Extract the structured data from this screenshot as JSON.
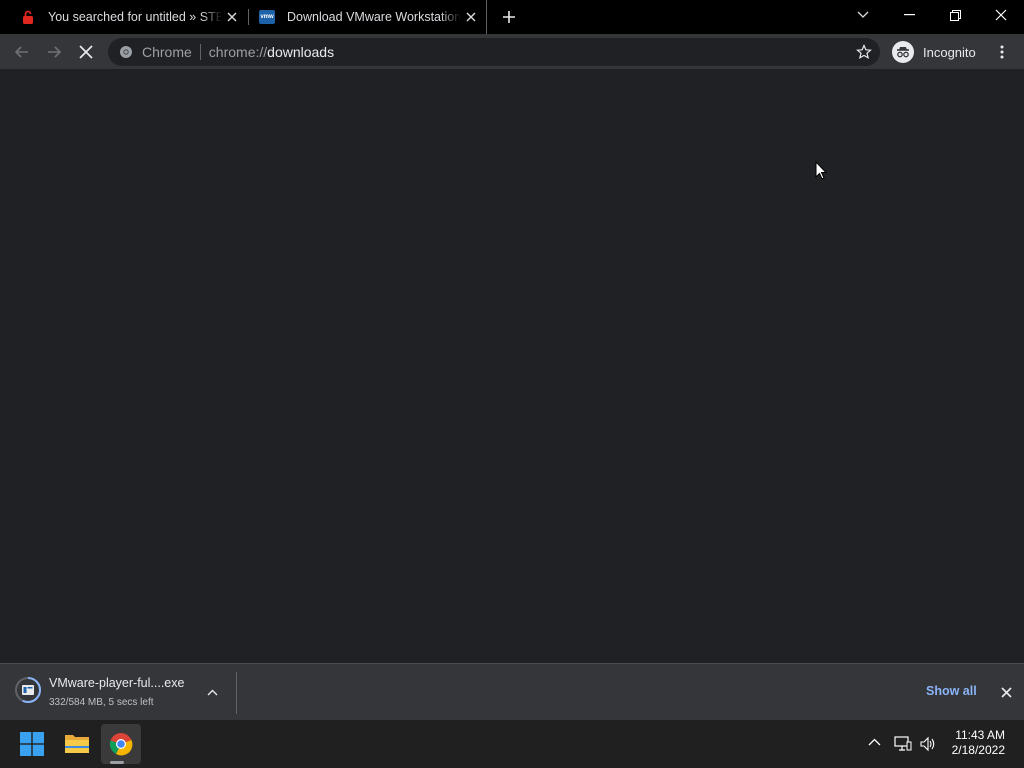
{
  "tabs": [
    {
      "title": "You searched for untitled » STEAM",
      "icon": "red-lock-icon"
    },
    {
      "title": "Download VMware Workstation Player",
      "icon": "vmware-icon",
      "favicon_text": "vmw"
    }
  ],
  "toolbar": {
    "site_chip": "Chrome",
    "url_scheme": "chrome://",
    "url_host": "downloads",
    "profile_label": "Incognito"
  },
  "download": {
    "filename": "VMware-player-ful....exe",
    "status": "332/584 MB, 5 secs left",
    "progress_fraction": 0.57,
    "show_all_label": "Show all"
  },
  "taskbar": {
    "time": "11:43 AM",
    "date": "2/18/2022"
  },
  "colors": {
    "accent": "#8ab4f8",
    "tab_strip": "#000000",
    "toolbar": "#35363a",
    "content": "#202124"
  }
}
